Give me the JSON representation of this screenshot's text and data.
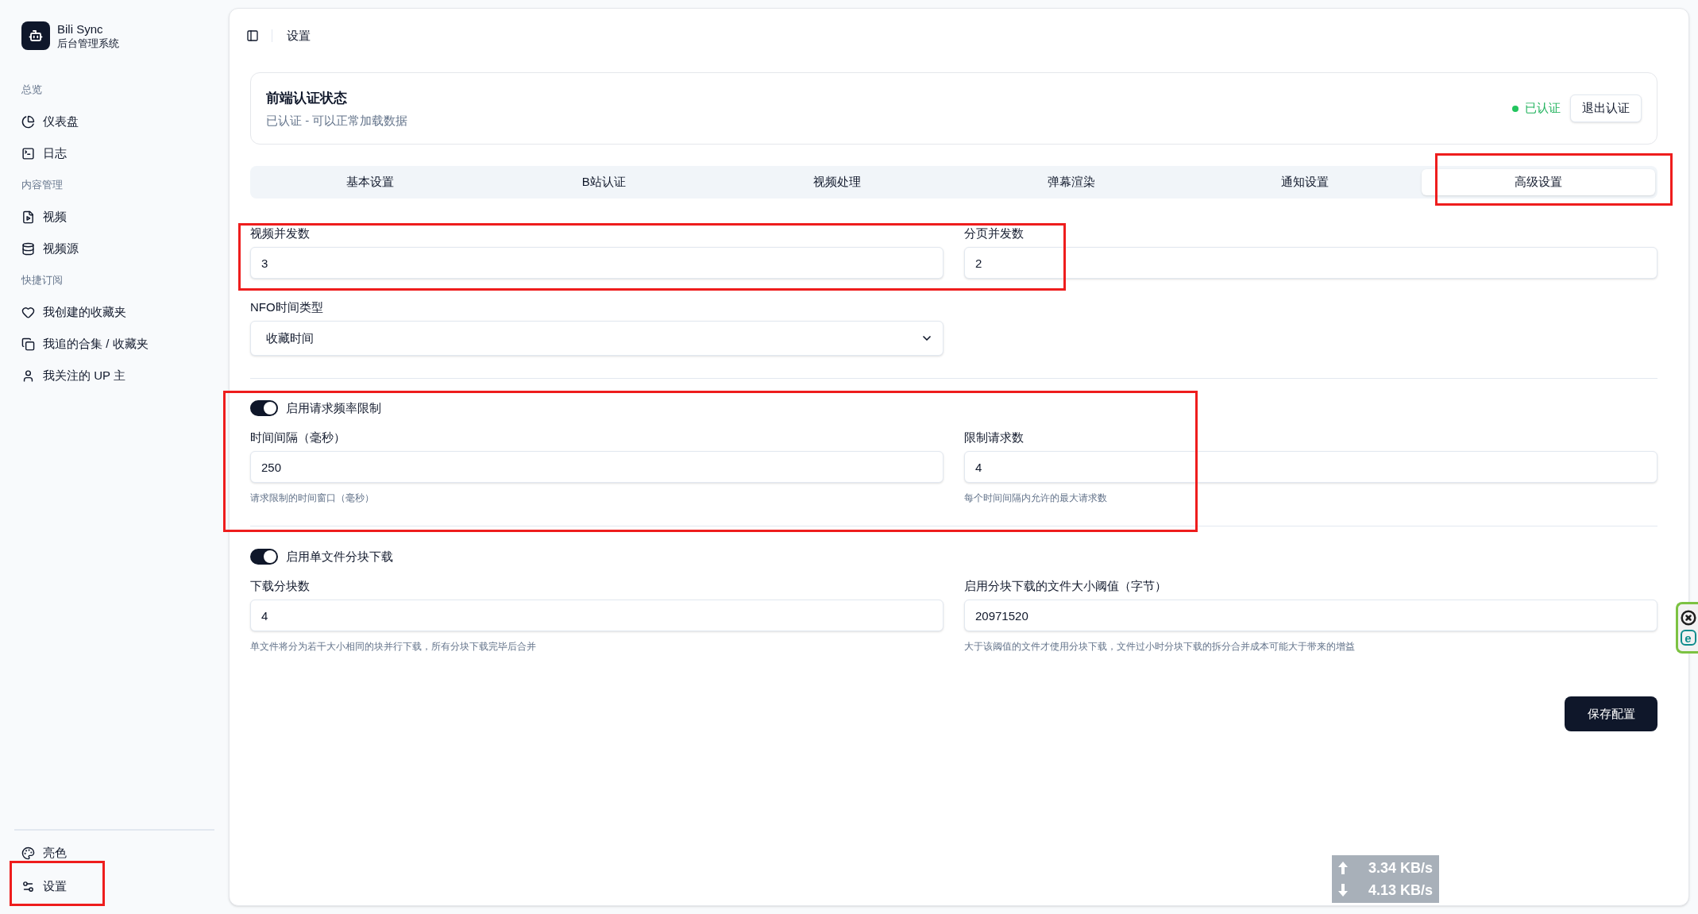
{
  "sidebar": {
    "brand": {
      "name": "Bili Sync",
      "subtitle": "后台管理系统"
    },
    "groups": [
      {
        "label": "总览",
        "items": [
          {
            "label": "仪表盘"
          },
          {
            "label": "日志"
          }
        ]
      },
      {
        "label": "内容管理",
        "items": [
          {
            "label": "视频"
          },
          {
            "label": "视频源"
          }
        ]
      },
      {
        "label": "快捷订阅",
        "items": [
          {
            "label": "我创建的收藏夹"
          },
          {
            "label": "我追的合集 / 收藏夹"
          },
          {
            "label": "我关注的 UP 主"
          }
        ]
      }
    ],
    "footer": [
      {
        "label": "亮色",
        "highlighted": false
      },
      {
        "label": "设置",
        "highlighted": true
      }
    ]
  },
  "header": {
    "breadcrumb": "设置"
  },
  "auth_card": {
    "title": "前端认证状态",
    "description": "已认证 - 可以正常加载数据",
    "status": {
      "label": "已认证",
      "authenticated": true
    },
    "logout_button": "退出认证"
  },
  "tabs": [
    {
      "label": "基本设置",
      "selected": false,
      "highlighted": false
    },
    {
      "label": "B站认证",
      "selected": false,
      "highlighted": false
    },
    {
      "label": "视频处理",
      "selected": false,
      "highlighted": false
    },
    {
      "label": "弹幕渲染",
      "selected": false,
      "highlighted": false
    },
    {
      "label": "通知设置",
      "selected": false,
      "highlighted": false
    },
    {
      "label": "高级设置",
      "selected": true,
      "highlighted": true
    }
  ],
  "form": {
    "concurrency": {
      "highlighted": true,
      "fields": [
        {
          "label": "视频并发数",
          "value": "3"
        },
        {
          "label": "分页并发数",
          "value": "2"
        }
      ]
    },
    "nfo_time_type": {
      "label": "NFO时间类型",
      "value": "收藏时间"
    },
    "rate_limit": {
      "highlighted": true,
      "toggle": {
        "label": "启用请求频率限制",
        "on": true
      },
      "fields": [
        {
          "label": "时间间隔（毫秒）",
          "value": "250",
          "hint": "请求限制的时间窗口（毫秒）"
        },
        {
          "label": "限制请求数",
          "value": "4",
          "hint": "每个时间间隔内允许的最大请求数"
        }
      ]
    },
    "chunked_download": {
      "toggle": {
        "label": "启用单文件分块下载",
        "on": true
      },
      "fields": [
        {
          "label": "下载分块数",
          "value": "4",
          "hint": "单文件将分为若干大小相同的块并行下载，所有分块下载完毕后合并"
        },
        {
          "label": "启用分块下载的文件大小阈值（字节）",
          "value": "20971520",
          "hint": "大于该阈值的文件才使用分块下载，文件过小时分块下载的拆分合并成本可能大于带来的增益"
        }
      ]
    }
  },
  "save_button": "保存配置",
  "network_monitor": {
    "upload": "3.34 KB/s",
    "download": "4.13 KB/s"
  },
  "edge_widget": {
    "badge": "e"
  }
}
